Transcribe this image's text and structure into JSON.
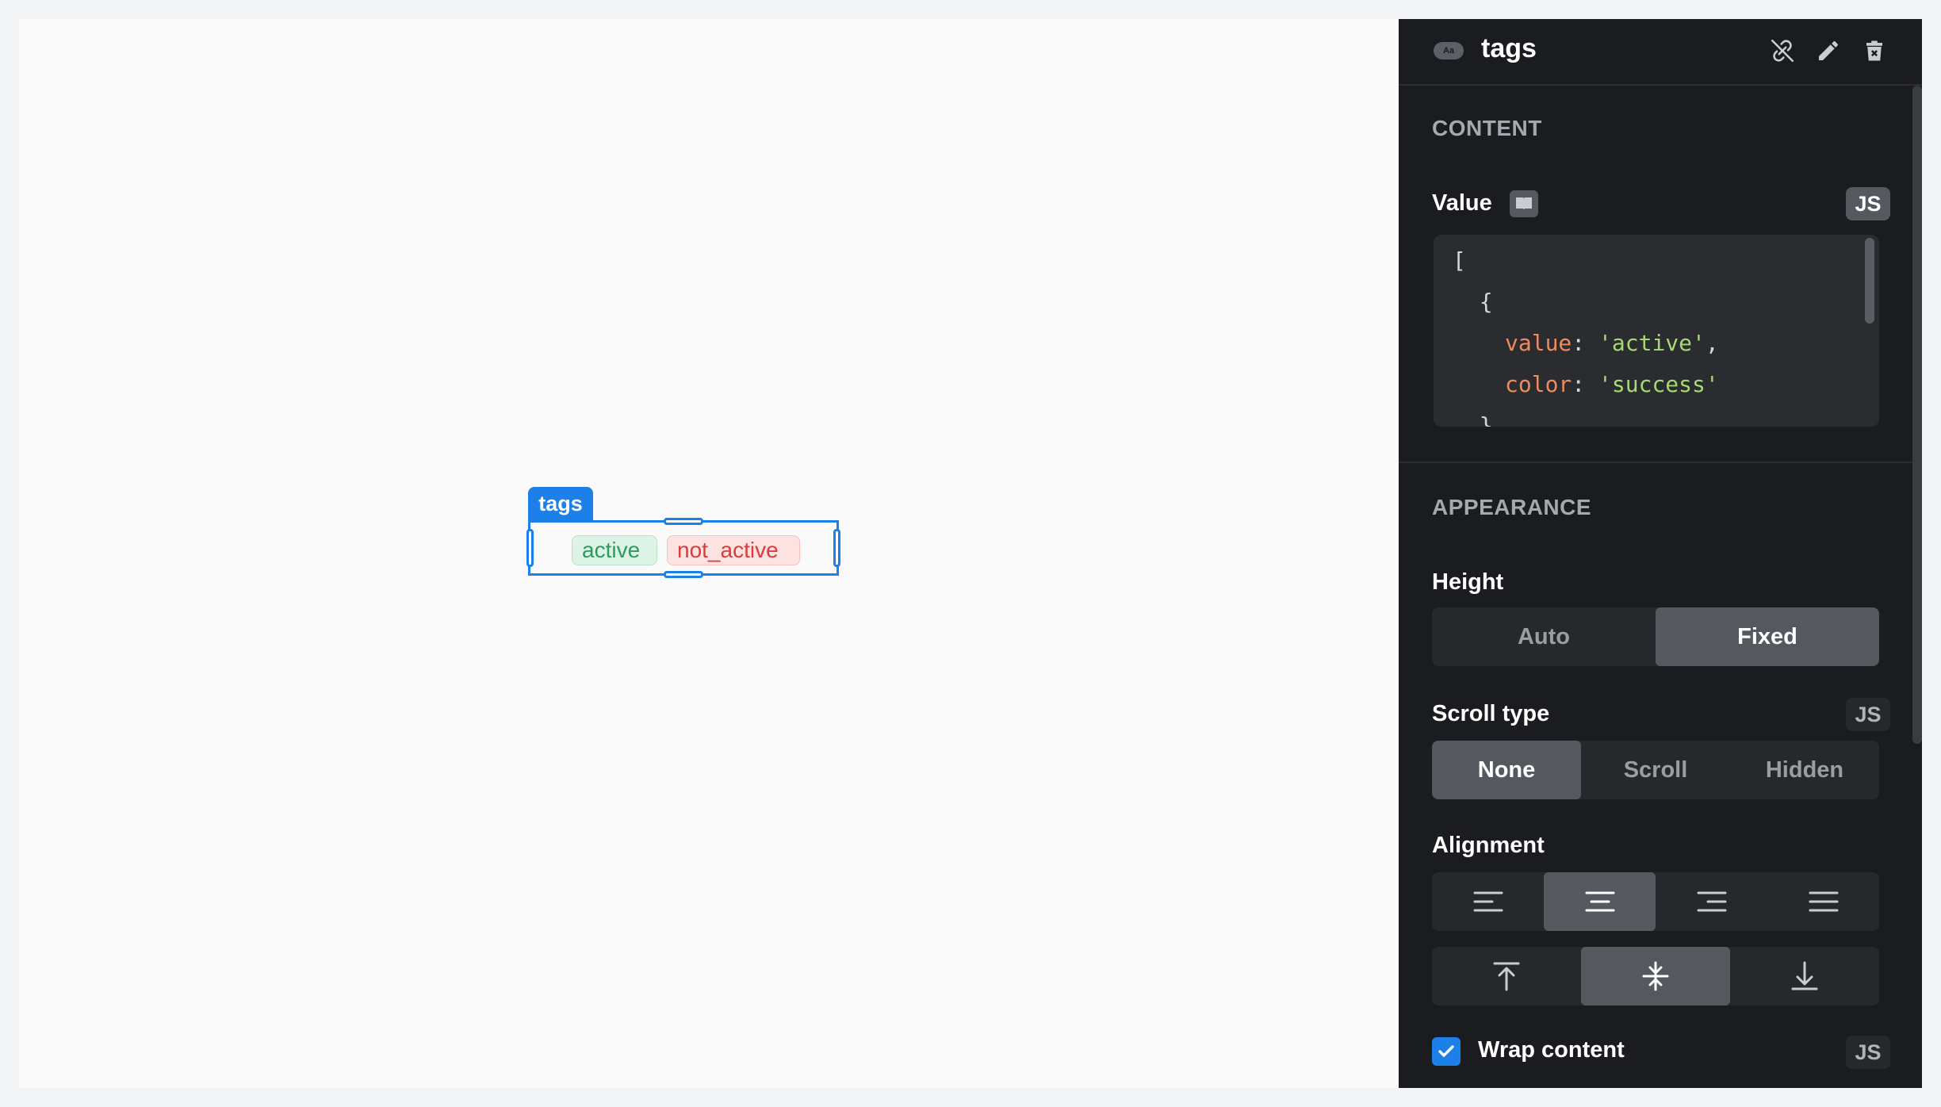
{
  "canvas": {
    "widget": {
      "label": "tags",
      "tags": [
        {
          "value": "active",
          "color": "success"
        },
        {
          "value": "not_active",
          "color": "danger"
        }
      ]
    }
  },
  "panel": {
    "title": "tags",
    "type_icon_text": "Aa",
    "header_icons": [
      "unlink-icon",
      "pencil-icon",
      "trash-icon"
    ],
    "content": {
      "section_title": "CONTENT",
      "value_label": "Value",
      "js_label": "JS",
      "code_lines": {
        "l1": "[",
        "l2": "  {",
        "l3_key": "value",
        "l3_val": "'active'",
        "l4_key": "color",
        "l4_val": "'success'",
        "l5": "  }"
      }
    },
    "appearance": {
      "section_title": "APPEARANCE",
      "height": {
        "label": "Height",
        "options": [
          "Auto",
          "Fixed"
        ],
        "selected": "Fixed"
      },
      "scroll_type": {
        "label": "Scroll type",
        "js_label": "JS",
        "options": [
          "None",
          "Scroll",
          "Hidden"
        ],
        "selected": "None"
      },
      "alignment": {
        "label": "Alignment",
        "horizontal": [
          "align-left-icon",
          "align-center-icon",
          "align-right-icon",
          "align-justify-icon"
        ],
        "horizontal_selected": "align-center-icon",
        "vertical": [
          "align-top-icon",
          "align-middle-icon",
          "align-bottom-icon"
        ],
        "vertical_selected": "align-middle-icon"
      },
      "wrap_content": {
        "label": "Wrap content",
        "checked": true,
        "js_label": "JS"
      }
    }
  },
  "colors": {
    "accent": "#1d7fe8",
    "success_text": "#2a9d5c",
    "danger_text": "#dc3b3b",
    "panel_bg": "#1b1c1f"
  }
}
